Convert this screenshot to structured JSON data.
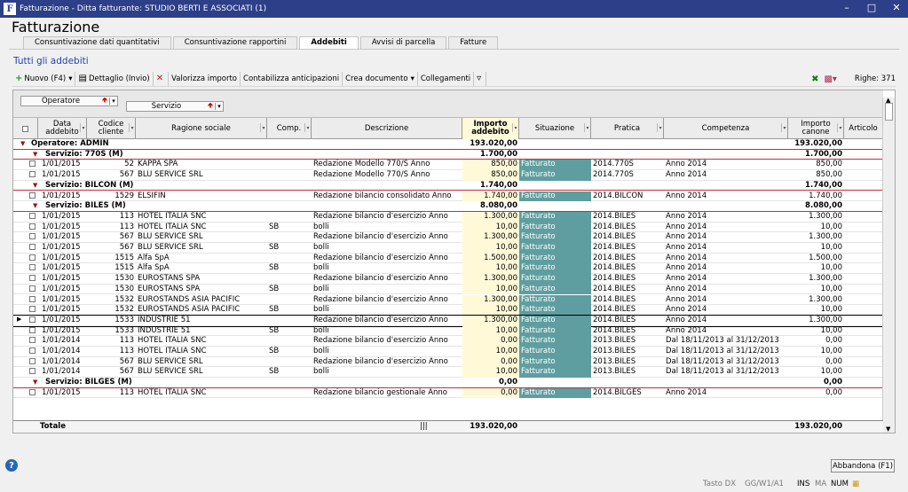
{
  "window": {
    "title": "Fatturazione - Ditta fatturante: STUDIO BERTI E ASSOCIATI (1)",
    "icon": "F"
  },
  "page_title": "Fatturazione",
  "tabs": [
    {
      "label": "Consuntivazione dati quantitativi",
      "active": false
    },
    {
      "label": "Consuntivazione rapportini",
      "active": false
    },
    {
      "label": "Addebiti",
      "active": true
    },
    {
      "label": "Avvisi di parcella",
      "active": false
    },
    {
      "label": "Fatture",
      "active": false
    }
  ],
  "section_title": "Tutti gli addebiti",
  "toolbar": {
    "nuovo": "Nuovo (F4)",
    "dettaglio": "Dettaglio (Invio)",
    "valorizza": "Valorizza importo",
    "contabilizza": "Contabilizza anticipazioni",
    "crea": "Crea documento",
    "collegamenti": "Collegamenti",
    "righe": "Righe: 371"
  },
  "group_by": [
    "Operatore",
    "Servizio"
  ],
  "columns": {
    "data": "Data addebito",
    "codice": "Codice cliente",
    "ragione": "Ragione sociale",
    "comp": "Comp.",
    "descrizione": "Descrizione",
    "importo": "Importo addebito",
    "situazione": "Situazione",
    "pratica": "Pratica",
    "competenza": "Competenza",
    "canone": "Importo canone",
    "articolo": "Articolo"
  },
  "colors": {
    "titlebar": "#2c3f88",
    "situazione": "#5f9ea0",
    "amount_bg": "#fff9d8",
    "group_line": "#c03040"
  },
  "rows": [
    {
      "type": "op",
      "label": "Operatore:  ADMIN",
      "importo": "193.020,00",
      "canone": "193.020,00"
    },
    {
      "type": "srv",
      "label": "Servizio:  770S (M)",
      "importo": "1.700,00",
      "canone": "1.700,00"
    },
    {
      "type": "d",
      "data": "1/01/2015",
      "cod": "52",
      "rag": "KAPPA SPA",
      "comp": "",
      "desc": "Redazione Modello 770/S Anno",
      "imp": "850,00",
      "sit": "Fatturato",
      "prat": "2014.770S",
      "compet": "Anno 2014",
      "can": "850,00"
    },
    {
      "type": "d",
      "data": "1/01/2015",
      "cod": "567",
      "rag": "BLU SERVICE SRL",
      "comp": "",
      "desc": "Redazione Modello 770/S Anno",
      "imp": "850,00",
      "sit": "Fatturato",
      "prat": "2014.770S",
      "compet": "Anno 2014",
      "can": "850,00"
    },
    {
      "type": "srv",
      "label": "Servizio:  BILCON (M)",
      "importo": "1.740,00",
      "canone": "1.740,00"
    },
    {
      "type": "d",
      "data": "1/01/2015",
      "cod": "1529",
      "rag": "ELSIFIN",
      "comp": "",
      "desc": "Redazione bilancio consolidato Anno",
      "imp": "1.740,00",
      "sit": "Fatturato",
      "prat": "2014.BILCON",
      "compet": "Anno 2014",
      "can": "1.740,00"
    },
    {
      "type": "srv",
      "label": "Servizio:  BILES (M)",
      "importo": "8.080,00",
      "canone": "8.080,00"
    },
    {
      "type": "d",
      "data": "1/01/2015",
      "cod": "113",
      "rag": "HOTEL ITALIA SNC",
      "comp": "",
      "desc": "Redazione bilancio d'esercizio Anno",
      "imp": "1.300,00",
      "sit": "Fatturato",
      "prat": "2014.BILES",
      "compet": "Anno 2014",
      "can": "1.300,00"
    },
    {
      "type": "d",
      "data": "1/01/2015",
      "cod": "113",
      "rag": "HOTEL ITALIA SNC",
      "comp": "SB",
      "desc": "bolli",
      "imp": "10,00",
      "sit": "Fatturato",
      "prat": "2014.BILES",
      "compet": "Anno 2014",
      "can": "10,00"
    },
    {
      "type": "d",
      "data": "1/01/2015",
      "cod": "567",
      "rag": "BLU SERVICE SRL",
      "comp": "",
      "desc": "Redazione bilancio d'esercizio Anno",
      "imp": "1.300,00",
      "sit": "Fatturato",
      "prat": "2014.BILES",
      "compet": "Anno 2014",
      "can": "1.300,00"
    },
    {
      "type": "d",
      "data": "1/01/2015",
      "cod": "567",
      "rag": "BLU SERVICE SRL",
      "comp": "SB",
      "desc": "bolli",
      "imp": "10,00",
      "sit": "Fatturato",
      "prat": "2014.BILES",
      "compet": "Anno 2014",
      "can": "10,00"
    },
    {
      "type": "d",
      "data": "1/01/2015",
      "cod": "1515",
      "rag": "Alfa SpA",
      "comp": "",
      "desc": "Redazione bilancio d'esercizio Anno",
      "imp": "1.500,00",
      "sit": "Fatturato",
      "prat": "2014.BILES",
      "compet": "Anno 2014",
      "can": "1.500,00"
    },
    {
      "type": "d",
      "data": "1/01/2015",
      "cod": "1515",
      "rag": "Alfa SpA",
      "comp": "SB",
      "desc": "bolli",
      "imp": "10,00",
      "sit": "Fatturato",
      "prat": "2014.BILES",
      "compet": "Anno 2014",
      "can": "10,00"
    },
    {
      "type": "d",
      "data": "1/01/2015",
      "cod": "1530",
      "rag": "EUROSTANS SPA",
      "comp": "",
      "desc": "Redazione bilancio d'esercizio Anno",
      "imp": "1.300,00",
      "sit": "Fatturato",
      "prat": "2014.BILES",
      "compet": "Anno 2014",
      "can": "1.300,00"
    },
    {
      "type": "d",
      "data": "1/01/2015",
      "cod": "1530",
      "rag": "EUROSTANS SPA",
      "comp": "SB",
      "desc": "bolli",
      "imp": "10,00",
      "sit": "Fatturato",
      "prat": "2014.BILES",
      "compet": "Anno 2014",
      "can": "10,00"
    },
    {
      "type": "d",
      "data": "1/01/2015",
      "cod": "1532",
      "rag": "EUROSTANDS ASIA PACIFIC",
      "comp": "",
      "desc": "Redazione bilancio d'esercizio Anno",
      "imp": "1.300,00",
      "sit": "Fatturato",
      "prat": "2014.BILES",
      "compet": "Anno 2014",
      "can": "1.300,00"
    },
    {
      "type": "d",
      "data": "1/01/2015",
      "cod": "1532",
      "rag": "EUROSTANDS ASIA PACIFIC",
      "comp": "SB",
      "desc": "bolli",
      "imp": "10,00",
      "sit": "Fatturato",
      "prat": "2014.BILES",
      "compet": "Anno 2014",
      "can": "10,00"
    },
    {
      "type": "d",
      "sel": true,
      "data": "1/01/2015",
      "cod": "1533",
      "rag": "INDUSTRIE 51",
      "comp": "",
      "desc": "Redazione bilancio d'esercizio Anno",
      "imp": "1.300,00",
      "sit": "Fatturato",
      "prat": "2014.BILES",
      "compet": "Anno 2014",
      "can": "1.300,00"
    },
    {
      "type": "d",
      "data": "1/01/2015",
      "cod": "1533",
      "rag": "INDUSTRIE 51",
      "comp": "SB",
      "desc": "bolli",
      "imp": "10,00",
      "sit": "Fatturato",
      "prat": "2014.BILES",
      "compet": "Anno 2014",
      "can": "10,00"
    },
    {
      "type": "d",
      "data": "1/01/2014",
      "cod": "113",
      "rag": "HOTEL ITALIA SNC",
      "comp": "",
      "desc": "Redazione bilancio d'esercizio Anno",
      "imp": "0,00",
      "sit": "Fatturato",
      "prat": "2013.BILES",
      "compet": "Dal 18/11/2013 al 31/12/2013",
      "can": "0,00"
    },
    {
      "type": "d",
      "data": "1/01/2014",
      "cod": "113",
      "rag": "HOTEL ITALIA SNC",
      "comp": "SB",
      "desc": "bolli",
      "imp": "10,00",
      "sit": "Fatturato",
      "prat": "2013.BILES",
      "compet": "Dal 18/11/2013 al 31/12/2013",
      "can": "10,00"
    },
    {
      "type": "d",
      "data": "1/01/2014",
      "cod": "567",
      "rag": "BLU SERVICE SRL",
      "comp": "",
      "desc": "Redazione bilancio d'esercizio Anno",
      "imp": "0,00",
      "sit": "Fatturato",
      "prat": "2013.BILES",
      "compet": "Dal 18/11/2013 al 31/12/2013",
      "can": "0,00"
    },
    {
      "type": "d",
      "data": "1/01/2014",
      "cod": "567",
      "rag": "BLU SERVICE SRL",
      "comp": "SB",
      "desc": "bolli",
      "imp": "10,00",
      "sit": "Fatturato",
      "prat": "2013.BILES",
      "compet": "Dal 18/11/2013 al 31/12/2013",
      "can": "10,00"
    },
    {
      "type": "srv",
      "label": "Servizio:  BILGES (M)",
      "importo": "0,00",
      "canone": "0,00"
    },
    {
      "type": "d",
      "data": "1/01/2015",
      "cod": "113",
      "rag": "HOTEL ITALIA SNC",
      "comp": "",
      "desc": "Redazione bilancio gestionale Anno",
      "imp": "0,00",
      "sit": "Fatturato",
      "prat": "2014.BILGES",
      "compet": "Anno 2014",
      "can": "0,00"
    }
  ],
  "total": {
    "label": "Totale",
    "importo": "193.020,00",
    "canone": "193.020,00"
  },
  "footer": {
    "abbandona": "Abbandona (F1)",
    "tasto_dx": "Tasto DX",
    "pos": "GG/W1/A1",
    "ins": "INS",
    "ma": "MA",
    "num": "NUM"
  }
}
